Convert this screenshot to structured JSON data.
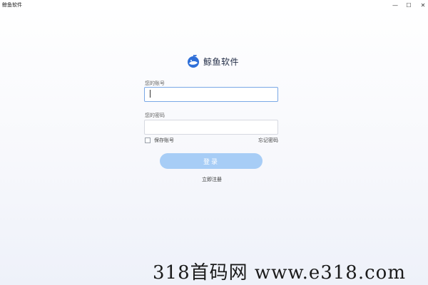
{
  "window": {
    "title": "鲸鱼软件",
    "controls": {
      "minimize": "—",
      "maximize": "☐",
      "close": "✕"
    }
  },
  "brand": {
    "name": "鲸鱼软件",
    "logo_icon": "whale-logo-icon",
    "accent_color": "#2f6fd8"
  },
  "login": {
    "account_label": "您的账号",
    "account_value": "",
    "password_label": "您的密码",
    "password_value": "",
    "remember_label": "保存账号",
    "remember_checked": false,
    "forgot_label": "忘记密码",
    "submit_label": "登录",
    "submit_color": "#a7cdf6",
    "register_label": "立即注册"
  },
  "watermark": {
    "text": "318首码网  www.e318.com"
  }
}
